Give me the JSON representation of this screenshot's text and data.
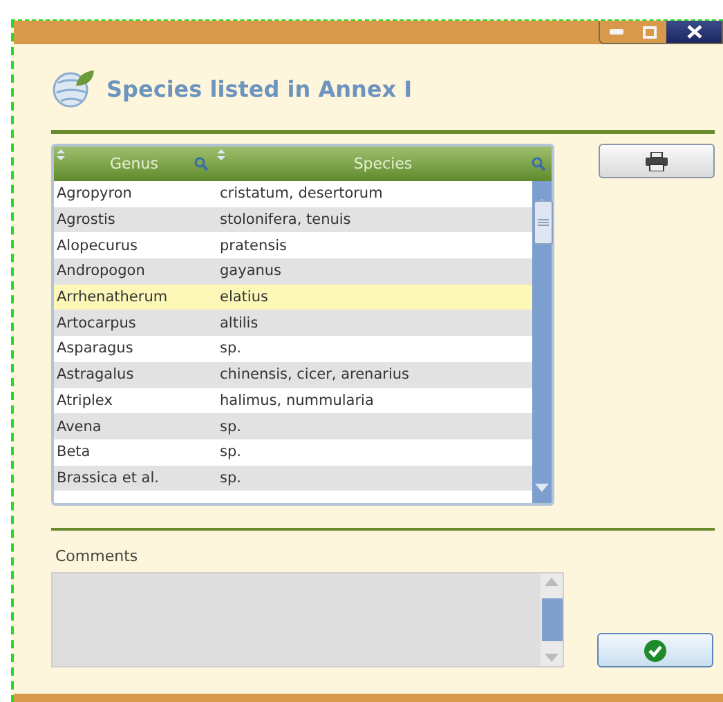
{
  "title": "Species listed in Annex I",
  "table": {
    "columns": [
      {
        "label": "Genus"
      },
      {
        "label": "Species"
      }
    ],
    "rows": [
      {
        "genus": "Agropyron",
        "species": "cristatum, desertorum",
        "selected": false
      },
      {
        "genus": "Agrostis",
        "species": "stolonifera, tenuis",
        "selected": false
      },
      {
        "genus": "Alopecurus",
        "species": "pratensis",
        "selected": false
      },
      {
        "genus": "Andropogon",
        "species": "gayanus",
        "selected": false
      },
      {
        "genus": "Arrhenatherum",
        "species": "elatius",
        "selected": true
      },
      {
        "genus": "Artocarpus",
        "species": "altilis",
        "selected": false
      },
      {
        "genus": "Asparagus",
        "species": "sp.",
        "selected": false
      },
      {
        "genus": "Astragalus",
        "species": "chinensis, cicer, arenarius",
        "selected": false
      },
      {
        "genus": "Atriplex",
        "species": "halimus, nummularia",
        "selected": false
      },
      {
        "genus": "Avena",
        "species": "sp.",
        "selected": false
      },
      {
        "genus": "Beta",
        "species": "sp.",
        "selected": false
      },
      {
        "genus": "Brassica et al.",
        "species": "sp.",
        "selected": false
      }
    ]
  },
  "comments": {
    "label": "Comments"
  }
}
